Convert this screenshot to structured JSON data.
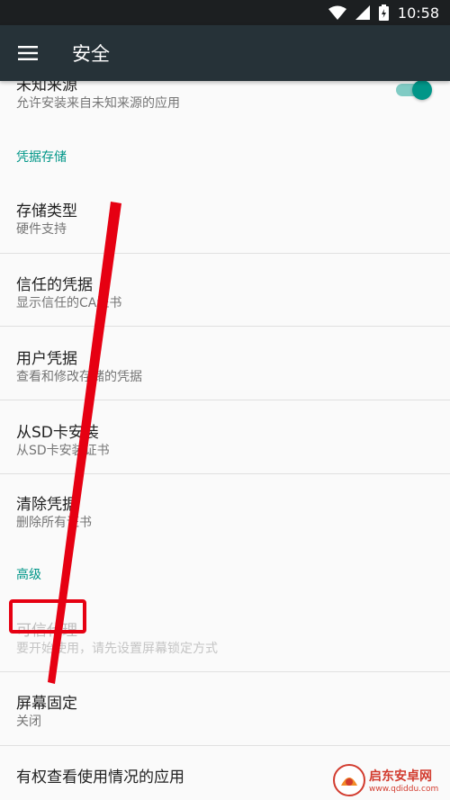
{
  "status_bar": {
    "time": "10:58"
  },
  "app_bar": {
    "title": "安全"
  },
  "unknown_sources": {
    "title": "未知来源",
    "summary": "允许安装来自未知来源的应用",
    "enabled": true
  },
  "credential_storage": {
    "header": "凭据存储",
    "items": [
      {
        "title": "存储类型",
        "summary": "硬件支持"
      },
      {
        "title": "信任的凭据",
        "summary": "显示信任的CA证书"
      },
      {
        "title": "用户凭据",
        "summary": "查看和修改存储的凭据"
      },
      {
        "title": "从SD卡安装",
        "summary": "从SD卡安装证书"
      },
      {
        "title": "清除凭据",
        "summary": "删除所有证书"
      }
    ]
  },
  "advanced": {
    "header": "高级",
    "trust_agents": {
      "title": "可信代理",
      "summary": "要开始使用，请先设置屏幕锁定方式"
    },
    "screen_pinning": {
      "title": "屏幕固定",
      "summary": "关闭"
    },
    "usage_access": {
      "title": "有权查看使用情况的应用"
    }
  },
  "watermark": {
    "name": "启东安卓网",
    "url": "www.qdiddu.com"
  },
  "colors": {
    "accent": "#009688",
    "toolbar": "#263238",
    "status_bar": "#1c1f21",
    "annotation": "#e60012"
  }
}
